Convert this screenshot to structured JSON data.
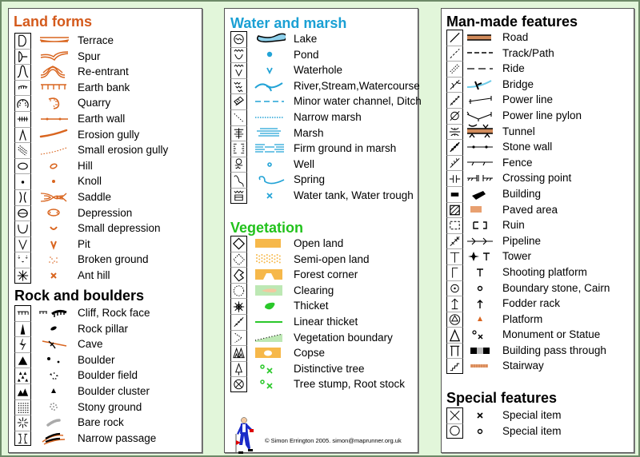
{
  "colors": {
    "background": "#e2f6da",
    "land_forms": "#d45a1c",
    "water": "#1aa0d4",
    "vegetation": "#22c21c",
    "man_made": "#000000"
  },
  "land_forms": {
    "title": "Land forms",
    "items": [
      {
        "label": "Terrace",
        "icon": "terrace-icon"
      },
      {
        "label": "Spur",
        "icon": "spur-icon"
      },
      {
        "label": "Re-entrant",
        "icon": "re-entrant-icon"
      },
      {
        "label": "Earth bank",
        "icon": "earth-bank-icon"
      },
      {
        "label": "Quarry",
        "icon": "quarry-icon"
      },
      {
        "label": "Earth wall",
        "icon": "earth-wall-icon"
      },
      {
        "label": "Erosion gully",
        "icon": "erosion-gully-icon"
      },
      {
        "label": "Small erosion gully",
        "icon": "small-erosion-gully-icon"
      },
      {
        "label": "Hill",
        "icon": "hill-icon"
      },
      {
        "label": "Knoll",
        "icon": "knoll-icon"
      },
      {
        "label": "Saddle",
        "icon": "saddle-icon"
      },
      {
        "label": "Depression",
        "icon": "depression-icon"
      },
      {
        "label": "Small depression",
        "icon": "small-depression-icon"
      },
      {
        "label": "Pit",
        "icon": "pit-icon"
      },
      {
        "label": "Broken ground",
        "icon": "broken-ground-icon"
      },
      {
        "label": "Ant hill",
        "icon": "ant-hill-icon"
      }
    ]
  },
  "rock_and_boulders": {
    "title": "Rock and boulders",
    "items": [
      {
        "label": "Cliff, Rock face",
        "icon": "cliff-icon"
      },
      {
        "label": "Rock pillar",
        "icon": "rock-pillar-icon"
      },
      {
        "label": "Cave",
        "icon": "cave-icon"
      },
      {
        "label": "Boulder",
        "icon": "boulder-icon"
      },
      {
        "label": "Boulder field",
        "icon": "boulder-field-icon"
      },
      {
        "label": "Boulder cluster",
        "icon": "boulder-cluster-icon"
      },
      {
        "label": "Stony ground",
        "icon": "stony-ground-icon"
      },
      {
        "label": "Bare rock",
        "icon": "bare-rock-icon"
      },
      {
        "label": "Narrow passage",
        "icon": "narrow-passage-icon"
      }
    ]
  },
  "water_and_marsh": {
    "title": "Water and marsh",
    "items": [
      {
        "label": "Lake",
        "icon": "lake-icon"
      },
      {
        "label": "Pond",
        "icon": "pond-icon"
      },
      {
        "label": "Waterhole",
        "icon": "waterhole-icon"
      },
      {
        "label": "River,Stream,Watercourse",
        "icon": "river-icon"
      },
      {
        "label": "Minor water channel, Ditch",
        "icon": "ditch-icon"
      },
      {
        "label": "Narrow marsh",
        "icon": "narrow-marsh-icon"
      },
      {
        "label": "Marsh",
        "icon": "marsh-icon"
      },
      {
        "label": "Firm ground in marsh",
        "icon": "firm-ground-icon"
      },
      {
        "label": "Well",
        "icon": "well-icon"
      },
      {
        "label": "Spring",
        "icon": "spring-icon"
      },
      {
        "label": "Water tank, Water trough",
        "icon": "water-tank-icon"
      }
    ]
  },
  "vegetation": {
    "title": "Vegetation",
    "items": [
      {
        "label": "Open land",
        "icon": "open-land-icon"
      },
      {
        "label": "Semi-open land",
        "icon": "semi-open-land-icon"
      },
      {
        "label": "Forest corner",
        "icon": "forest-corner-icon"
      },
      {
        "label": "Clearing",
        "icon": "clearing-icon"
      },
      {
        "label": "Thicket",
        "icon": "thicket-icon"
      },
      {
        "label": "Linear thicket",
        "icon": "linear-thicket-icon"
      },
      {
        "label": "Vegetation boundary",
        "icon": "vegetation-boundary-icon"
      },
      {
        "label": "Copse",
        "icon": "copse-icon"
      },
      {
        "label": "Distinctive tree",
        "icon": "distinctive-tree-icon"
      },
      {
        "label": "Tree stump, Root stock",
        "icon": "tree-stump-icon"
      }
    ]
  },
  "man_made_features": {
    "title": "Man-made features",
    "items": [
      {
        "label": "Road",
        "icon": "road-icon"
      },
      {
        "label": "Track/Path",
        "icon": "track-icon"
      },
      {
        "label": "Ride",
        "icon": "ride-icon"
      },
      {
        "label": "Bridge",
        "icon": "bridge-icon"
      },
      {
        "label": "Power line",
        "icon": "power-line-icon"
      },
      {
        "label": "Power line pylon",
        "icon": "pylon-icon"
      },
      {
        "label": "Tunnel",
        "icon": "tunnel-icon"
      },
      {
        "label": "Stone wall",
        "icon": "stone-wall-icon"
      },
      {
        "label": "Fence",
        "icon": "fence-icon"
      },
      {
        "label": "Crossing point",
        "icon": "crossing-point-icon"
      },
      {
        "label": "Building",
        "icon": "building-icon"
      },
      {
        "label": "Paved area",
        "icon": "paved-area-icon"
      },
      {
        "label": "Ruin",
        "icon": "ruin-icon"
      },
      {
        "label": "Pipeline",
        "icon": "pipeline-icon"
      },
      {
        "label": "Tower",
        "icon": "tower-icon"
      },
      {
        "label": "Shooting platform",
        "icon": "shooting-platform-icon"
      },
      {
        "label": "Boundary stone, Cairn",
        "icon": "cairn-icon"
      },
      {
        "label": "Fodder rack",
        "icon": "fodder-rack-icon"
      },
      {
        "label": "Platform",
        "icon": "platform-icon"
      },
      {
        "label": "Monument or Statue",
        "icon": "monument-icon"
      },
      {
        "label": "Building pass through",
        "icon": "pass-through-icon"
      },
      {
        "label": "Stairway",
        "icon": "stairway-icon"
      }
    ]
  },
  "special_features": {
    "title": "Special features",
    "items": [
      {
        "label": "Special item",
        "icon": "special-cross-icon"
      },
      {
        "label": "Special item",
        "icon": "special-circle-icon"
      }
    ]
  },
  "footer": {
    "copyright": "© Simon Errington 2005. simon@maprunner.org.uk"
  }
}
